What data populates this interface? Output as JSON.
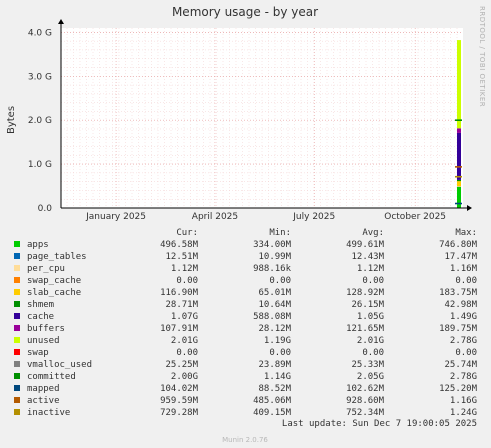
{
  "side_label": "RRDTOOL / TOBI OETIKER",
  "footer": {
    "last_update": "Last update:  Sun Dec  7 19:00:05 2025",
    "version": "Munin 2.0.76"
  },
  "legend_headers": [
    "Cur:",
    "Min:",
    "Avg:",
    "Max:"
  ],
  "chart_data": {
    "type": "area",
    "title": "Memory usage - by year",
    "ylabel": "Bytes",
    "x_ticks": [
      "January 2025",
      "April 2025",
      "July 2025",
      "October 2025"
    ],
    "y_ticks": [
      "0.0",
      "1.0 G",
      "2.0 G",
      "3.0 G",
      "4.0 G"
    ],
    "ylim": [
      0,
      4.1
    ],
    "grid": true,
    "series": [
      {
        "name": "apps",
        "color": "#00cc00",
        "cur": "496.58M",
        "min": "334.00M",
        "avg": "499.61M",
        "max": "746.80M"
      },
      {
        "name": "page_tables",
        "color": "#0066b3",
        "cur": "12.51M",
        "min": "10.99M",
        "avg": "12.43M",
        "max": "17.47M"
      },
      {
        "name": "per_cpu",
        "color": "#ffdd99",
        "cur": "1.12M",
        "min": "988.16k",
        "avg": "1.12M",
        "max": "1.16M"
      },
      {
        "name": "swap_cache",
        "color": "#ff8000",
        "cur": "0.00",
        "min": "0.00",
        "avg": "0.00",
        "max": "0.00"
      },
      {
        "name": "slab_cache",
        "color": "#ffcc00",
        "cur": "116.90M",
        "min": "65.01M",
        "avg": "128.92M",
        "max": "183.75M"
      },
      {
        "name": "shmem",
        "color": "#008f00",
        "cur": "28.71M",
        "min": "10.64M",
        "avg": "26.15M",
        "max": "42.98M"
      },
      {
        "name": "cache",
        "color": "#330099",
        "cur": "1.07G",
        "min": "588.08M",
        "avg": "1.05G",
        "max": "1.49G"
      },
      {
        "name": "buffers",
        "color": "#990099",
        "cur": "107.91M",
        "min": "28.12M",
        "avg": "121.65M",
        "max": "189.75M"
      },
      {
        "name": "unused",
        "color": "#ccff00",
        "cur": "2.01G",
        "min": "1.19G",
        "avg": "2.01G",
        "max": "2.78G"
      },
      {
        "name": "swap",
        "color": "#ff0000",
        "cur": "0.00",
        "min": "0.00",
        "avg": "0.00",
        "max": "0.00"
      },
      {
        "name": "vmalloc_used",
        "color": "#808080",
        "cur": "25.25M",
        "min": "23.89M",
        "avg": "25.33M",
        "max": "25.74M"
      },
      {
        "name": "committed",
        "color": "#008f00",
        "cur": "2.00G",
        "min": "1.14G",
        "avg": "2.05G",
        "max": "2.78G"
      },
      {
        "name": "mapped",
        "color": "#00487d",
        "cur": "104.02M",
        "min": "88.52M",
        "avg": "102.62M",
        "max": "125.20M"
      },
      {
        "name": "active",
        "color": "#b35a00",
        "cur": "959.59M",
        "min": "485.06M",
        "avg": "928.60M",
        "max": "1.16G"
      },
      {
        "name": "inactive",
        "color": "#b38f00",
        "cur": "729.28M",
        "min": "409.15M",
        "avg": "752.34M",
        "max": "1.24G"
      }
    ],
    "stack_now_gb": [
      0.485,
      0.012,
      0.001,
      0.0,
      0.114,
      0.028,
      1.07,
      0.105,
      2.01,
      0.0
    ],
    "line_now_gb": {
      "committed": 2.0,
      "active": 0.937,
      "inactive": 0.712,
      "mapped": 0.102
    }
  }
}
